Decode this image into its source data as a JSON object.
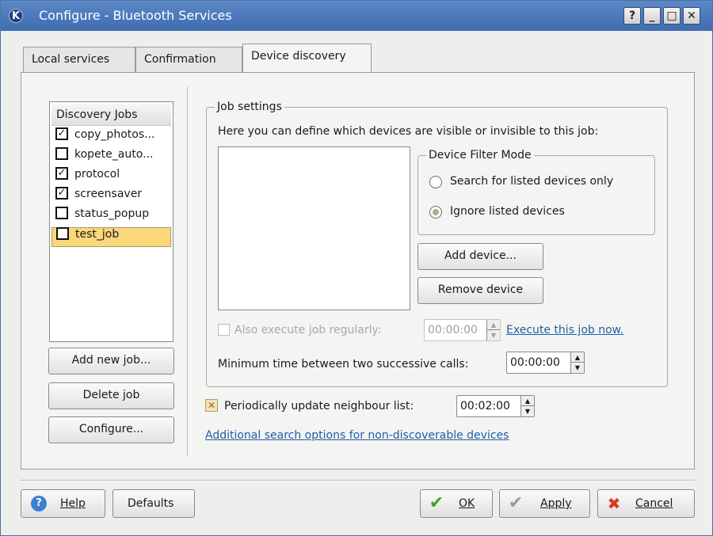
{
  "window": {
    "title": "Configure - Bluetooth Services",
    "controls": {
      "help": "?",
      "minimize": "_",
      "maximize": "□",
      "close": "✕"
    }
  },
  "tabs": [
    {
      "label": "Local services"
    },
    {
      "label": "Confirmation"
    },
    {
      "label": "Device discovery",
      "active": true
    }
  ],
  "jobs": {
    "header": "Discovery Jobs",
    "items": [
      {
        "label": "copy_photos...",
        "checked": true
      },
      {
        "label": "kopete_auto...",
        "checked": false
      },
      {
        "label": "protocol",
        "checked": true
      },
      {
        "label": "screensaver",
        "checked": true
      },
      {
        "label": "status_popup",
        "checked": false
      },
      {
        "label": "test_job",
        "checked": false,
        "selected": true
      }
    ],
    "add_button": "Add new job...",
    "delete_button": "Delete job",
    "configure_button": "Configure..."
  },
  "job_settings": {
    "title": "Job settings",
    "description": "Here you can define which devices are visible or invisible to this job:",
    "filter_mode": {
      "title": "Device Filter Mode",
      "option_listed_only": "Search for listed devices only",
      "option_ignore": "Ignore listed devices",
      "selected": "option_ignore"
    },
    "add_device_button": "Add device...",
    "remove_device_button": "Remove device",
    "also_execute_label": "Also execute job regularly:",
    "also_execute_time": "00:00:00",
    "execute_now_link": "Execute this job now.",
    "min_time_label": "Minimum time between two successive calls:",
    "min_time_value": "00:00:00"
  },
  "periodic": {
    "label": "Periodically update neighbour list:",
    "checked": true,
    "value": "00:02:00"
  },
  "additional_link": "Additional search options for non-discoverable devices",
  "buttons": {
    "help": "Help",
    "defaults": "Defaults",
    "ok": "OK",
    "apply": "Apply",
    "cancel": "Cancel"
  },
  "colors": {
    "titlebar": "#4a78bb",
    "selection": "#fbd77c",
    "link": "#1f5fa8",
    "ok_icon": "#3aa62e",
    "cancel_icon": "#d83a1e"
  }
}
